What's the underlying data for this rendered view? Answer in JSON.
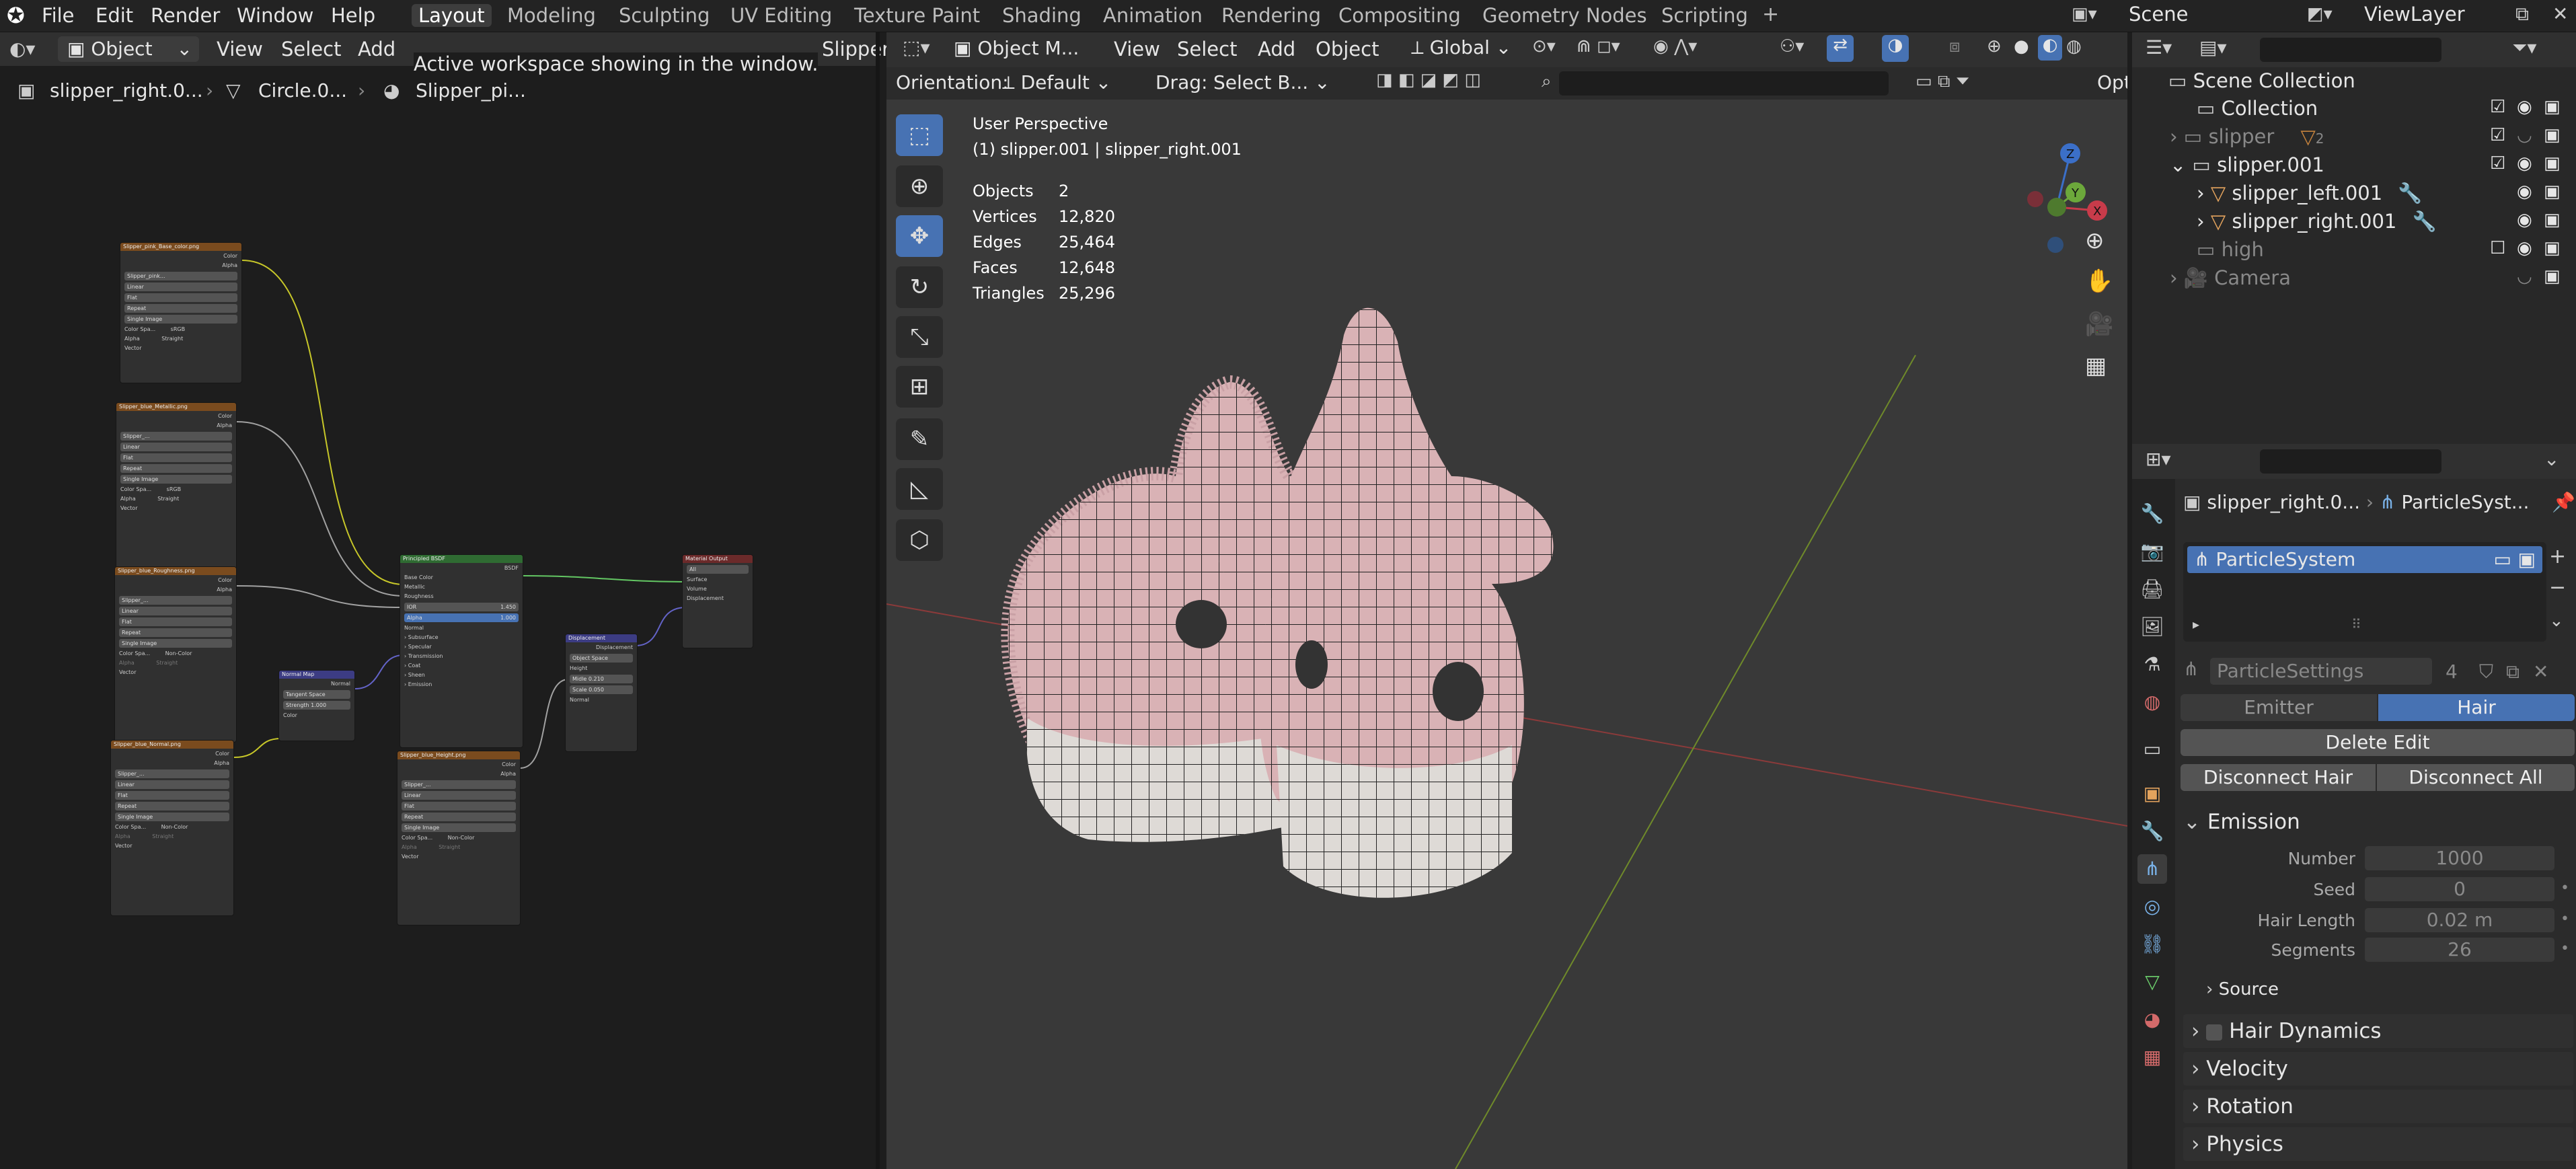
{
  "topbar": {
    "menu": [
      "File",
      "Edit",
      "Render",
      "Window",
      "Help"
    ],
    "workspaces": [
      "Layout",
      "Modeling",
      "Sculpting",
      "UV Editing",
      "Texture Paint",
      "Shading",
      "Animation",
      "Rendering",
      "Compositing",
      "Geometry Nodes",
      "Scripting"
    ],
    "active_workspace": "Layout",
    "scene": "Scene",
    "view_layer": "ViewLayer"
  },
  "tooltip": "Active workspace showing in the window.",
  "node_editor": {
    "mode": "Object",
    "menu": [
      "View",
      "Select",
      "Add"
    ],
    "slot_tab": "Slipper",
    "breadcrumb": [
      "slipper_right.0...",
      "Circle.0...",
      "Slipper_pi..."
    ],
    "nodes": {
      "tex1": {
        "title": "Slipper_pink_Base_color.png",
        "img": "Slipper_pink...",
        "rows": [
          "Linear",
          "Flat",
          "Repeat",
          "Single Image"
        ],
        "cs_label": "Color Spa...",
        "cs": "sRGB",
        "alpha_label": "Alpha",
        "alpha": "Straight"
      },
      "tex2": {
        "title": "Slipper_blue_Metallic.png",
        "img": "Slipper_...",
        "rows": [
          "Linear",
          "Flat",
          "Repeat",
          "Single Image"
        ],
        "cs_label": "Color Spa...",
        "cs": "sRGB",
        "alpha_label": "Alpha",
        "alpha": "Straight"
      },
      "tex3": {
        "title": "Slipper_blue_Roughness.png",
        "img": "Slipper_...",
        "rows": [
          "Linear",
          "Flat",
          "Repeat",
          "Single Image"
        ],
        "cs_label": "Color Spa...",
        "cs": "Non-Color",
        "alpha_label": "Alpha",
        "alpha": "Straight"
      },
      "tex4": {
        "title": "Slipper_blue_Normal.png",
        "img": "Slipper_...",
        "rows": [
          "Linear",
          "Flat",
          "Repeat",
          "Single Image"
        ],
        "cs_label": "Color Spa...",
        "cs": "Non-Color",
        "alpha_label": "Alpha",
        "alpha": "Straight"
      },
      "tex5": {
        "title": "Slipper_blue_Height.png",
        "img": "Slipper_...",
        "rows": [
          "Linear",
          "Flat",
          "Repeat",
          "Single Image"
        ],
        "cs_label": "Color Spa...",
        "cs": "Non-Color",
        "alpha_label": "Alpha",
        "alpha": "Straight"
      },
      "normal_map": {
        "title": "Normal Map",
        "out": "Normal",
        "space": "Tangent Space",
        "strength": "Strength  1.000",
        "in": "Color"
      },
      "bsdf": {
        "title": "Principled BSDF",
        "out": "BSDF",
        "inputs": [
          "Base Color",
          "Metallic",
          "Roughness"
        ],
        "ior": "IOR",
        "ior_v": "1.450",
        "alpha": "Alpha",
        "alpha_v": "1.000",
        "normal": "Normal",
        "subs": [
          "Subsurface",
          "Specular",
          "Transmission",
          "Coat",
          "Sheen",
          "Emission"
        ]
      },
      "displacement": {
        "title": "Displacement",
        "out": "Displacement",
        "space": "Object Space",
        "height": "Height",
        "midlevel": "Midle  0.210",
        "scale": "Scale  0.050",
        "normal": "Normal"
      },
      "output": {
        "title": "Material Output",
        "target": "All",
        "inputs": [
          "Surface",
          "Volume",
          "Displacement"
        ]
      },
      "socket_labels": {
        "color": "Color",
        "alpha": "Alpha",
        "vector": "Vector"
      }
    }
  },
  "viewport": {
    "mode": "Object M...",
    "menu": [
      "View",
      "Select",
      "Add",
      "Object"
    ],
    "transform": "Global",
    "orientation_label": "Orientation:",
    "orientation": "Default",
    "drag_label": "Drag:",
    "drag": "Select B...",
    "options": "Opt",
    "view_name": "User Perspective",
    "active_info": "(1) slipper.001 | slipper_right.001",
    "stats": [
      {
        "label": "Objects",
        "value": "2"
      },
      {
        "label": "Vertices",
        "value": "12,820"
      },
      {
        "label": "Edges",
        "value": "25,464"
      },
      {
        "label": "Faces",
        "value": "12,648"
      },
      {
        "label": "Triangles",
        "value": "25,296"
      }
    ],
    "gizmo": {
      "x": "X",
      "y": "Y",
      "z": "Z"
    }
  },
  "outliner": {
    "root": "Scene Collection",
    "items": [
      {
        "label": "Collection",
        "depth": 1
      },
      {
        "label": "slipper",
        "depth": 1,
        "badge": "2"
      },
      {
        "label": "slipper.001",
        "depth": 1
      },
      {
        "label": "slipper_left.001",
        "depth": 2
      },
      {
        "label": "slipper_right.001",
        "depth": 2
      },
      {
        "label": "high",
        "depth": 1
      },
      {
        "label": "Camera",
        "depth": 1
      }
    ]
  },
  "properties": {
    "breadcrumb": [
      "slipper_right.0...",
      "ParticleSyst..."
    ],
    "particle_system": "ParticleSystem",
    "settings": "ParticleSettings",
    "settings_users": "4",
    "type_options": [
      "Emitter",
      "Hair"
    ],
    "type_active": "Hair",
    "delete_edit": "Delete Edit",
    "disconnect_hair": "Disconnect Hair",
    "disconnect_all": "Disconnect All",
    "emission": {
      "title": "Emission",
      "fields": [
        {
          "label": "Number",
          "value": "1000"
        },
        {
          "label": "Seed",
          "value": "0"
        },
        {
          "label": "Hair Length",
          "value": "0.02 m"
        },
        {
          "label": "Segments",
          "value": "26"
        }
      ],
      "source": "Source"
    },
    "panels": [
      "Hair Dynamics",
      "Velocity",
      "Rotation",
      "Physics"
    ]
  },
  "colors": {
    "accent": "#4772b3",
    "header": "#303030",
    "texture_node": "#7a4b1e",
    "vector_node": "#3c3c83",
    "shader_node": "#2f6b32",
    "output_node": "#6b2a2a"
  }
}
